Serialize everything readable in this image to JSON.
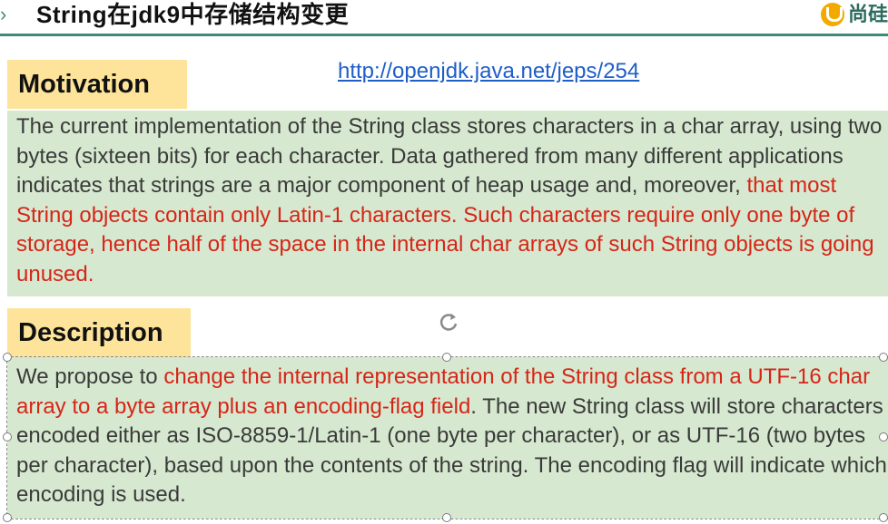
{
  "slide": {
    "title": "String在jdk9中存储结构变更",
    "logo_text": "尚硅"
  },
  "link": {
    "text": "http://openjdk.java.net/jeps/254"
  },
  "motivation": {
    "heading": "Motivation",
    "text_plain": "The current implementation of the String class stores characters in a char array, using two bytes (sixteen bits) for each character. Data gathered from many different applications indicates that strings are a major component of heap usage and, moreover, ",
    "text_highlight": "that most String objects contain only Latin-1 characters. Such characters require only one byte of storage, hence half of the space in the internal char arrays of such String objects is going unused."
  },
  "description": {
    "heading": "Description",
    "text_before": "We propose to ",
    "text_highlight": "change the internal representation of the String class from a UTF-16 char array to a byte array plus an encoding-flag field",
    "text_after": ". The new String class will store characters encoded either as ISO-8859-1/Latin-1 (one byte per character), or as UTF-16 (two bytes per character), based upon the contents of the string. The encoding flag will indicate which encoding is used."
  },
  "colors": {
    "accent_teal": "#3d8c7a",
    "heading_bg": "#fde49a",
    "box_bg": "#d6e8cf",
    "highlight_red": "#d62518",
    "link_blue": "#1f5ec7"
  }
}
